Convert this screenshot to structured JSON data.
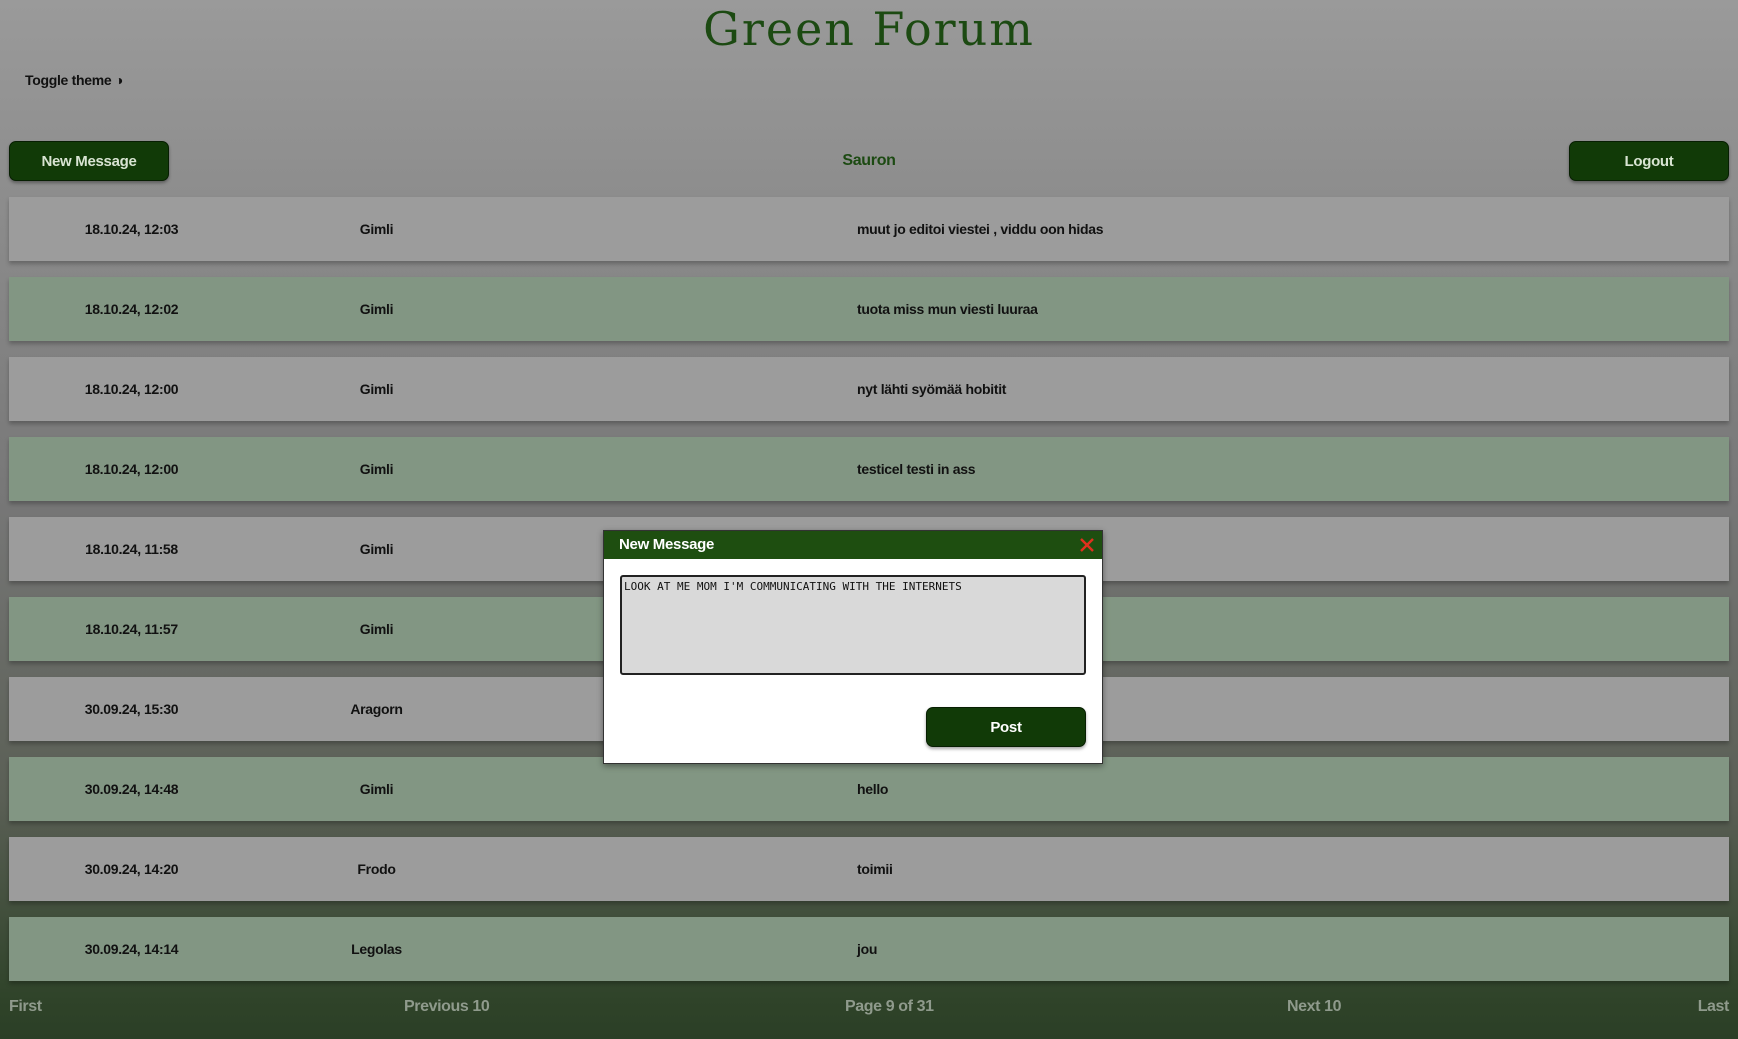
{
  "header": {
    "title": "Green Forum",
    "toggle_theme": "Toggle theme ◑"
  },
  "toolbar": {
    "new_message_label": "New Message",
    "current_user": "Sauron",
    "logout_label": "Logout"
  },
  "messages": [
    {
      "time": "18.10.24, 12:03",
      "user": "Gimli",
      "text": "muut jo editoi viestei , viddu oon hidas"
    },
    {
      "time": "18.10.24, 12:02",
      "user": "Gimli",
      "text": "tuota miss mun viesti luuraa"
    },
    {
      "time": "18.10.24, 12:00",
      "user": "Gimli",
      "text": "nyt lähti syömää hobitit"
    },
    {
      "time": "18.10.24, 12:00",
      "user": "Gimli",
      "text": "testicel testi in ass"
    },
    {
      "time": "18.10.24, 11:58",
      "user": "Gimli",
      "text": ""
    },
    {
      "time": "18.10.24, 11:57",
      "user": "Gimli",
      "text": ""
    },
    {
      "time": "30.09.24, 15:30",
      "user": "Aragorn",
      "text": ""
    },
    {
      "time": "30.09.24, 14:48",
      "user": "Gimli",
      "text": "hello"
    },
    {
      "time": "30.09.24, 14:20",
      "user": "Frodo",
      "text": "toimii"
    },
    {
      "time": "30.09.24, 14:14",
      "user": "Legolas",
      "text": "jou"
    }
  ],
  "pager": {
    "first": "First",
    "previous": "Previous 10",
    "info": "Page 9 of 31",
    "next": "Next 10",
    "last": "Last"
  },
  "modal": {
    "title": "New Message",
    "textarea_value": "LOOK AT ME MOM I'M COMMUNICATING WITH THE INTERNETS",
    "post_label": "Post"
  },
  "colors": {
    "brand_green": "#113a07",
    "row_grey": "#9c9c9c",
    "row_green": "#829683",
    "close_red": "#e0301e"
  }
}
